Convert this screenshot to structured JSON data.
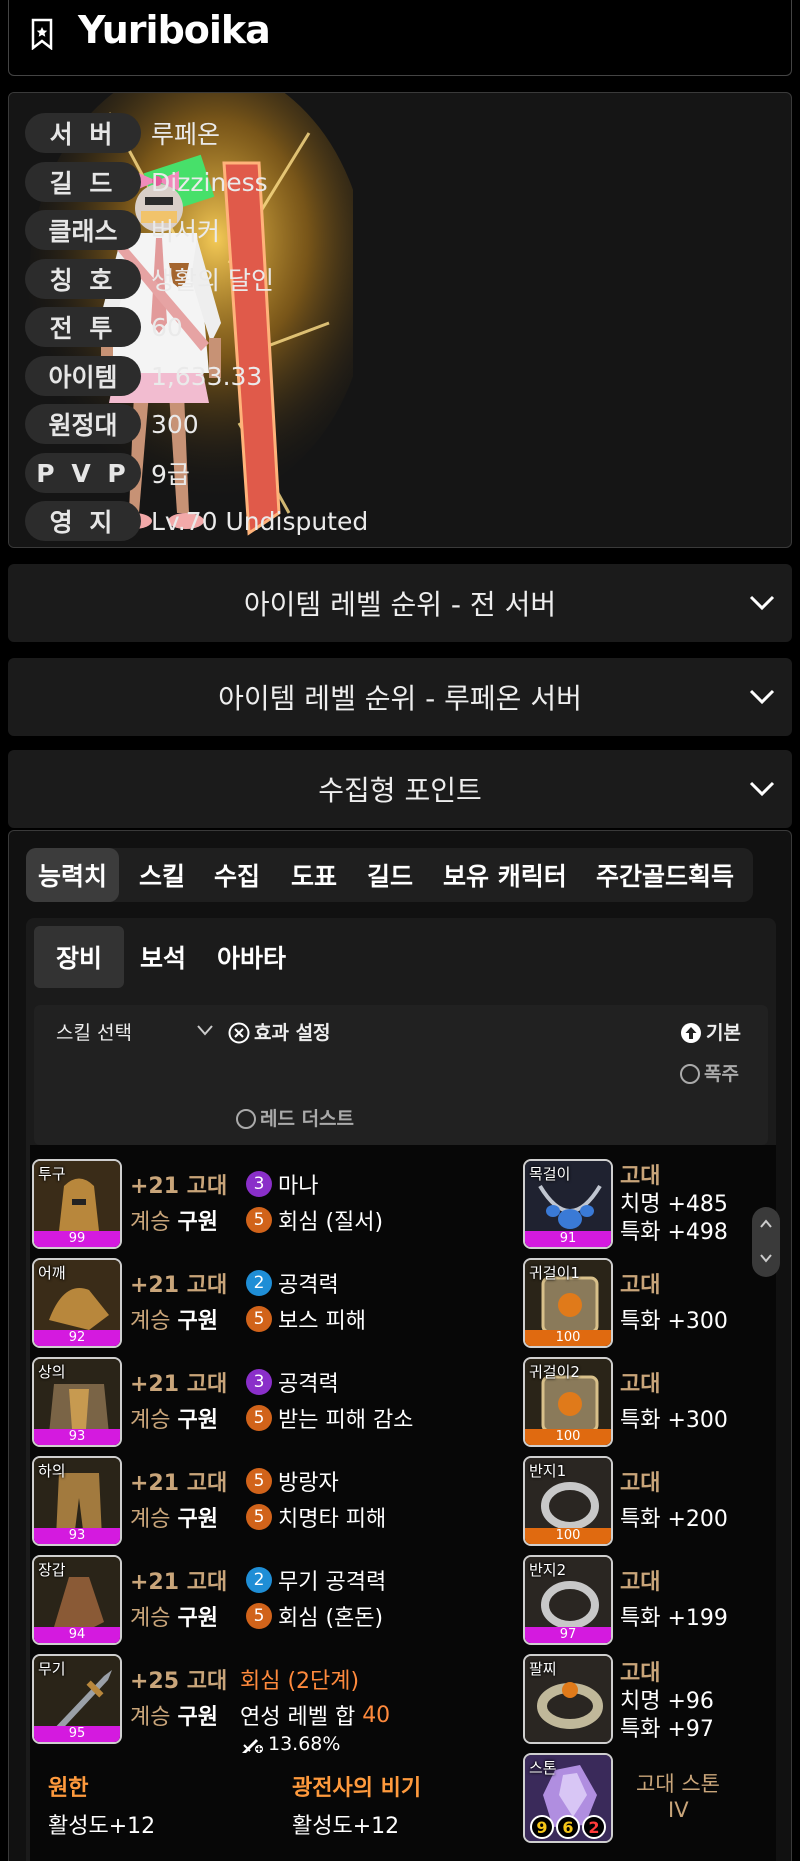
{
  "character": {
    "name": "Yuriboika"
  },
  "profile": [
    {
      "label": "서 버",
      "value": "루페온"
    },
    {
      "label": "길 드",
      "value": "Dizziness"
    },
    {
      "label": "클래스",
      "value": "버서커"
    },
    {
      "label": "칭 호",
      "value": "생활의 달인"
    },
    {
      "label": "전 투",
      "value": "60"
    },
    {
      "label": "아이템",
      "value": "1,633.33"
    },
    {
      "label": "원정대",
      "value": "300"
    },
    {
      "label": "P V P",
      "value": "9급"
    },
    {
      "label": "영 지",
      "value": "Lv.70 Undisputed"
    }
  ],
  "accordions": [
    {
      "title": "아이템 레벨 순위 - 전 서버"
    },
    {
      "title": "아이템 레벨 순위 - 루페온 서버"
    },
    {
      "title": "수집형 포인트"
    }
  ],
  "tabs": [
    "능력치",
    "스킬",
    "수집",
    "도표",
    "길드",
    "보유 캐릭터",
    "주간골드획득"
  ],
  "subtabs": [
    "장비",
    "보석",
    "아바타"
  ],
  "filter": {
    "skill_select": "스킬 선택",
    "effect_setting": "효과 설정",
    "basic": "기본",
    "frenzy": "폭주",
    "red_dust": "레드 더스트"
  },
  "equipment": [
    {
      "slot": "투구",
      "quality": "99",
      "grade": "+21 고대",
      "succession": "계승",
      "set": "구원",
      "eng": [
        {
          "lv": "3",
          "name": "마나",
          "color": "purple"
        },
        {
          "lv": "5",
          "name": "회심 (질서)",
          "color": "orange"
        }
      ]
    },
    {
      "slot": "어깨",
      "quality": "92",
      "grade": "+21 고대",
      "succession": "계승",
      "set": "구원",
      "eng": [
        {
          "lv": "2",
          "name": "공격력",
          "color": "blue"
        },
        {
          "lv": "5",
          "name": "보스 피해",
          "color": "orange"
        }
      ]
    },
    {
      "slot": "상의",
      "quality": "93",
      "grade": "+21 고대",
      "succession": "계승",
      "set": "구원",
      "eng": [
        {
          "lv": "3",
          "name": "공격력",
          "color": "purple"
        },
        {
          "lv": "5",
          "name": "받는 피해 감소",
          "color": "orange"
        }
      ]
    },
    {
      "slot": "하의",
      "quality": "93",
      "grade": "+21 고대",
      "succession": "계승",
      "set": "구원",
      "eng": [
        {
          "lv": "5",
          "name": "방랑자",
          "color": "orange"
        },
        {
          "lv": "5",
          "name": "치명타 피해",
          "color": "orange"
        }
      ]
    },
    {
      "slot": "장갑",
      "quality": "94",
      "grade": "+21 고대",
      "succession": "계승",
      "set": "구원",
      "eng": [
        {
          "lv": "2",
          "name": "무기 공격력",
          "color": "blue"
        },
        {
          "lv": "5",
          "name": "회심 (혼돈)",
          "color": "orange"
        }
      ]
    }
  ],
  "weapon": {
    "slot": "무기",
    "quality": "95",
    "grade": "+25 고대",
    "succession": "계승",
    "set": "구원",
    "elixir": "회심 (2단계)",
    "elixir_sum_label": "연성 레벨 합",
    "elixir_sum": "40",
    "extra": "13.68%"
  },
  "bracelet_effects": [
    {
      "name": "원한",
      "value": "활성도+12"
    },
    {
      "name": "광전사의 비기",
      "value": "활성도+12"
    }
  ],
  "accessories": [
    {
      "slot": "목걸이",
      "quality": "91",
      "grade": "고대",
      "stats": [
        "치명 +485",
        "특화 +498"
      ]
    },
    {
      "slot": "귀걸이1",
      "quality": "100",
      "grade": "고대",
      "stats": [
        "특화 +300"
      ]
    },
    {
      "slot": "귀걸이2",
      "quality": "100",
      "grade": "고대",
      "stats": [
        "특화 +300"
      ]
    },
    {
      "slot": "반지1",
      "quality": "100",
      "grade": "고대",
      "stats": [
        "특화 +200"
      ]
    },
    {
      "slot": "반지2",
      "quality": "97",
      "grade": "고대",
      "stats": [
        "특화 +199"
      ]
    },
    {
      "slot": "팔찌",
      "quality": "",
      "grade": "고대",
      "stats": [
        "치명 +96",
        "특화 +97"
      ]
    }
  ],
  "stone": {
    "slot": "스톤",
    "name": "고대 스톤",
    "tier": "IV",
    "values": [
      "9",
      "6",
      "2"
    ]
  },
  "colors": {
    "accent_gold": "#c9a57a",
    "quality_magenta": "#d41adf",
    "quality_orange": "#e06a10",
    "elixir_orange": "#ff8a3d"
  }
}
